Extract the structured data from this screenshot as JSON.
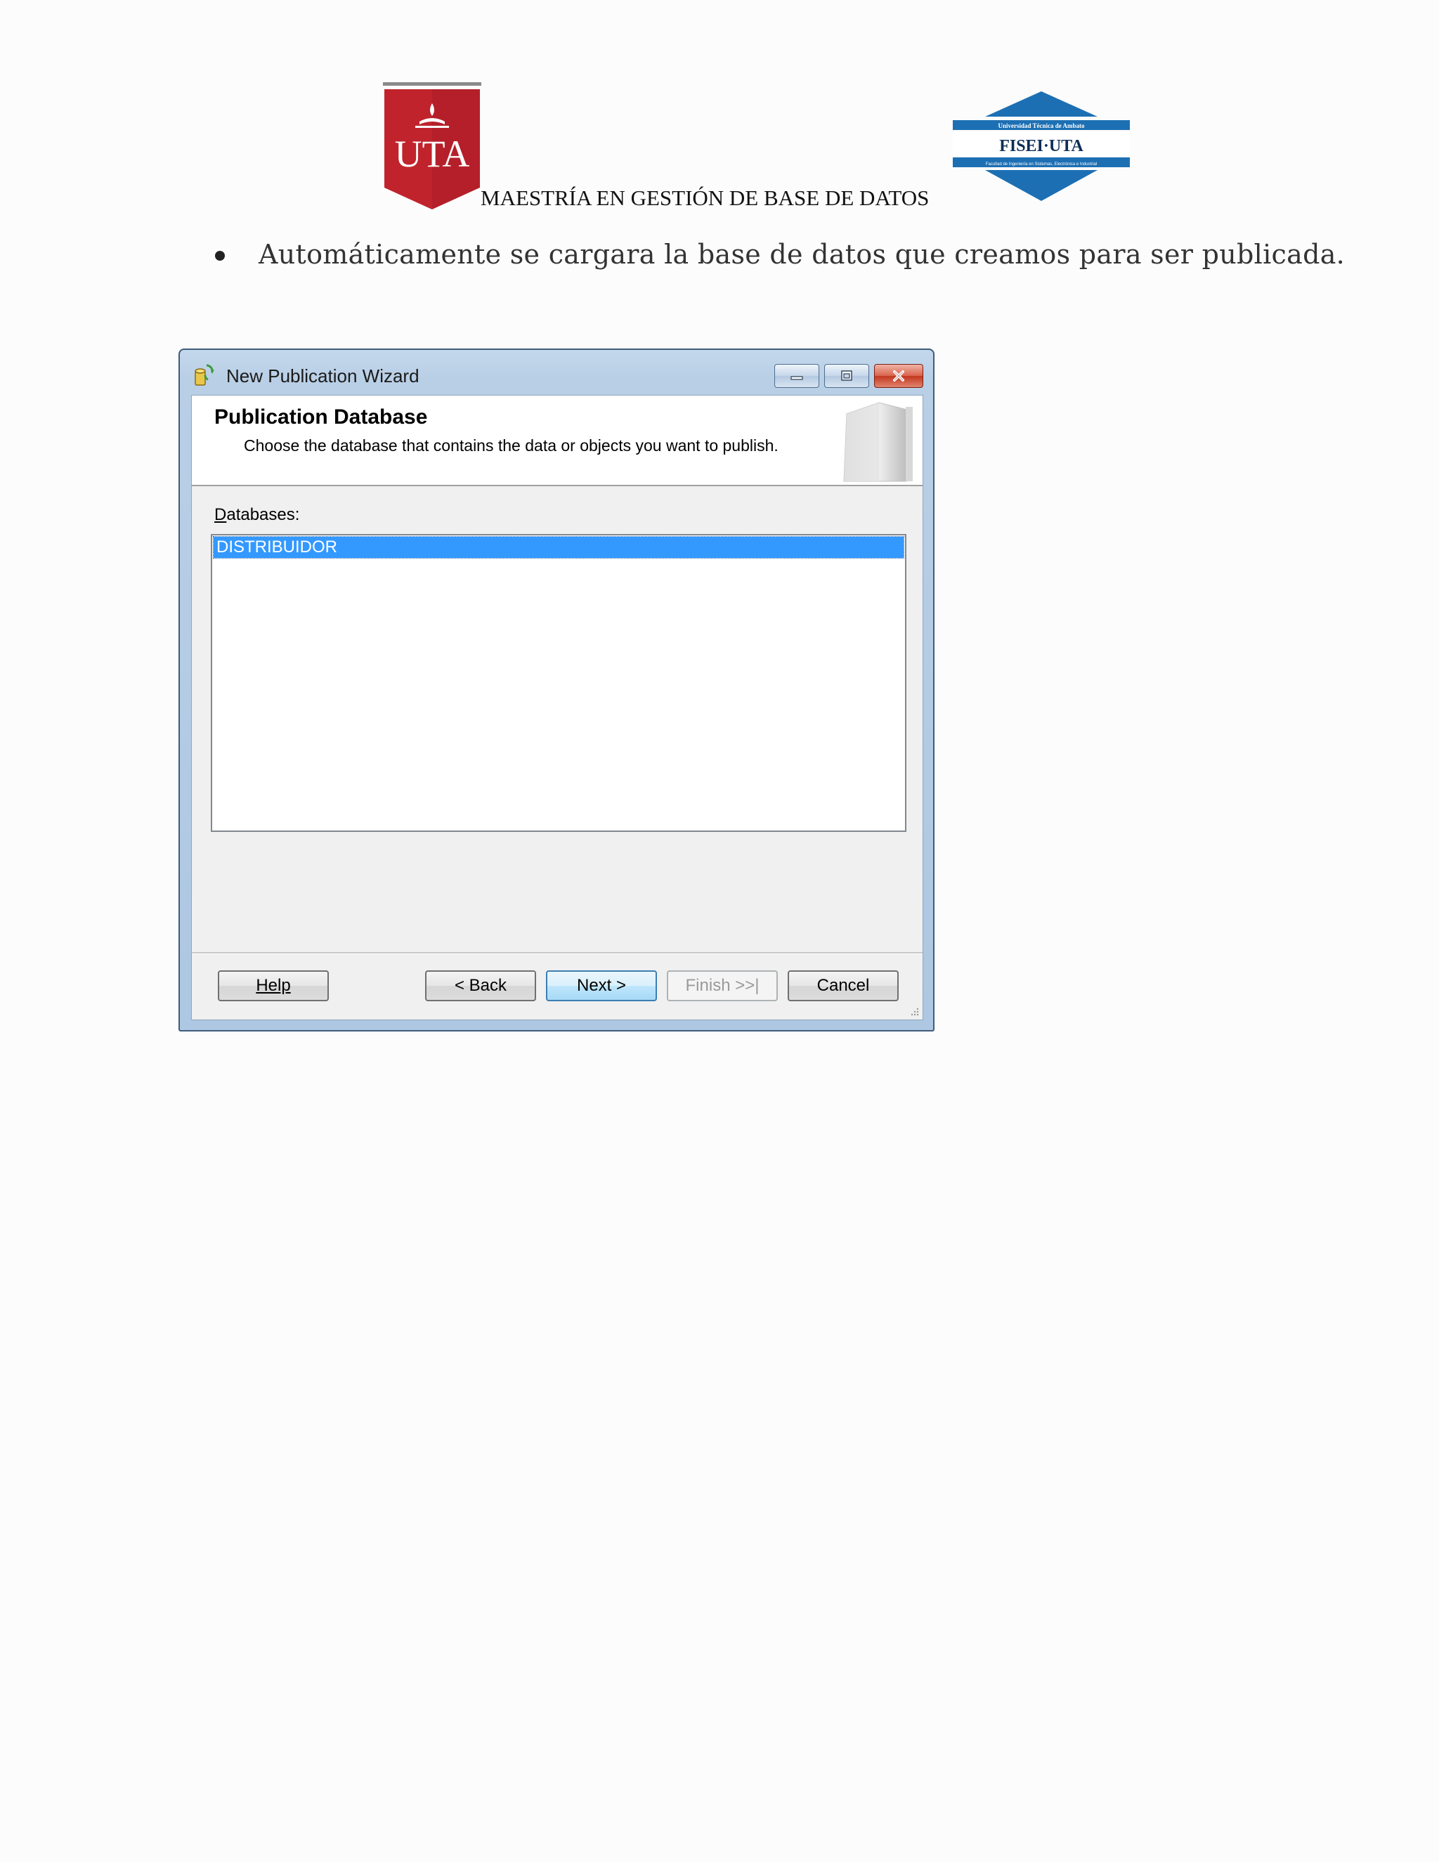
{
  "document": {
    "header_text": "MAESTRÍA EN GESTIÓN DE BASE DE DATOS",
    "uta_logo_text": "UTA",
    "fisei_logo_text": "FISEI·UTA",
    "fisei_logo_subtext_top": "Universidad Técnica de Ambato",
    "fisei_logo_subtext_bottom": "Facultad de Ingeniería en Sistemas, Electrónica e Industrial",
    "bullet_text": "Automáticamente se cargara la base de datos que creamos para ser publicada."
  },
  "window": {
    "title": "New Publication Wizard",
    "icon": "wizard-icon",
    "controls": [
      "minimize-icon",
      "maximize-icon",
      "close-icon"
    ],
    "banner": {
      "title": "Publication Database",
      "description": "Choose the database that contains the data or objects you want to publish."
    },
    "databases_label": "Databases:",
    "databases": [
      {
        "name": "DISTRIBUIDOR",
        "selected": true
      }
    ],
    "buttons": {
      "help": "Help",
      "back": "< Back",
      "next": "Next >",
      "finish": "Finish >>|",
      "cancel": "Cancel"
    },
    "colors": {
      "selection": "#3399ff",
      "titlebar": "#b9cfe6",
      "close_button": "#c3361e"
    }
  }
}
